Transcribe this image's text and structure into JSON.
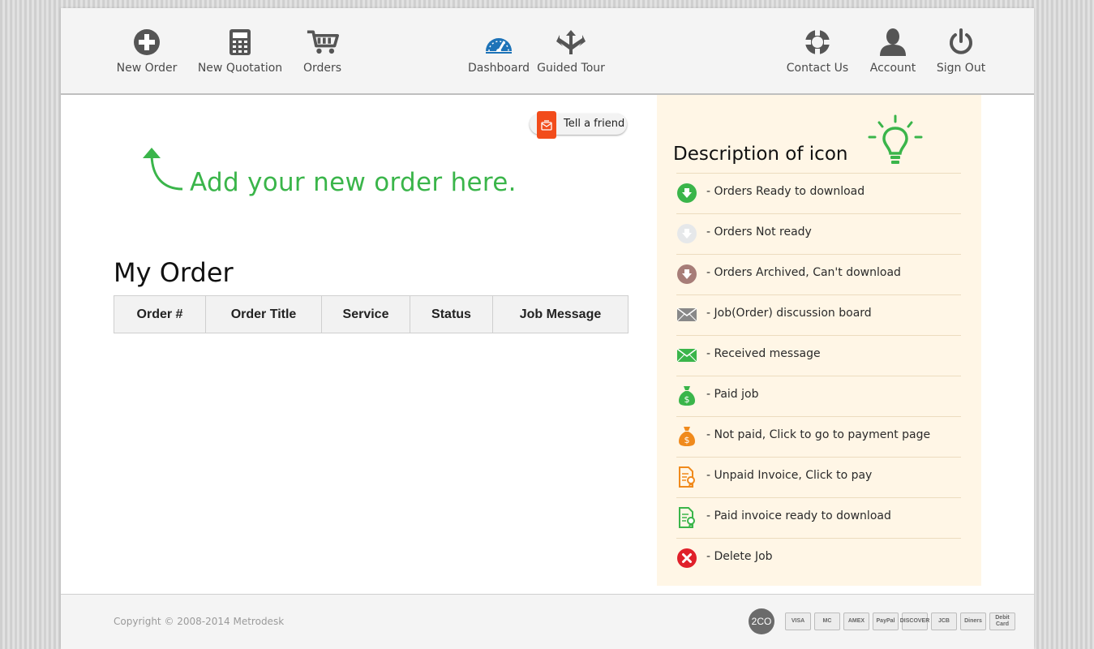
{
  "nav": {
    "new_order": "New Order",
    "new_quotation": "New Quotation",
    "orders": "Orders",
    "dashboard": "Dashboard",
    "guided_tour": "Guided Tour",
    "contact_us": "Contact Us",
    "account": "Account",
    "sign_out": "Sign Out"
  },
  "tell_friend": {
    "label": "Tell a friend",
    "icon": "share-icon"
  },
  "add_hint": "Add your new order here.",
  "my_order": {
    "title": "My Order",
    "columns": [
      "Order #",
      "Order Title",
      "Service",
      "Status",
      "Job Message"
    ]
  },
  "legend": {
    "title": "Description of icon",
    "items": [
      {
        "icon": "download-ready-icon",
        "label": "- Orders Ready to download"
      },
      {
        "icon": "download-not-ready-icon",
        "label": "- Orders Not ready"
      },
      {
        "icon": "archived-icon",
        "label": "- Orders Archived, Can't download"
      },
      {
        "icon": "discussion-envelope-icon",
        "label": "- Job(Order) discussion board"
      },
      {
        "icon": "received-message-icon",
        "label": "- Received message"
      },
      {
        "icon": "paid-money-bag-icon",
        "label": "- Paid job"
      },
      {
        "icon": "unpaid-money-bag-icon",
        "label": "- Not paid, Click to go to payment page"
      },
      {
        "icon": "unpaid-invoice-icon",
        "label": "- Unpaid Invoice, Click to pay"
      },
      {
        "icon": "paid-invoice-icon",
        "label": "- Paid invoice ready to download"
      },
      {
        "icon": "delete-icon",
        "label": "- Delete Job"
      }
    ]
  },
  "footer": {
    "copyright": "Copyright © 2008-2014 Metrodesk",
    "payment_logo": "2CO",
    "cards": [
      "VISA",
      "MC",
      "AMEX",
      "PayPal",
      "DISCOVER",
      "JCB",
      "Diners",
      "Debit Card"
    ]
  },
  "colors": {
    "accent_green": "#3ab54a",
    "legend_bg": "#fff6e6",
    "dashboard_blue": "#1d73b8",
    "tell_friend_orange": "#f24c1b",
    "unpaid_orange": "#f08a1c",
    "delete_red": "#e0202a"
  }
}
